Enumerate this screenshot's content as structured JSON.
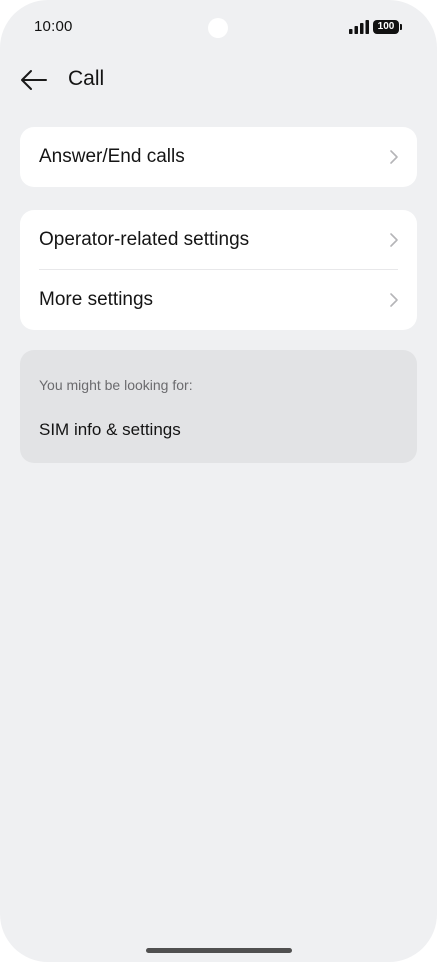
{
  "status_bar": {
    "time": "10:00",
    "battery_level": "100",
    "signal_icon": "signal-bars-icon",
    "battery_icon": "battery-icon"
  },
  "header": {
    "back_icon": "arrow-left-icon",
    "title": "Call"
  },
  "groups": [
    {
      "items": [
        {
          "label": "Answer/End calls",
          "icon": "chevron-right-icon"
        }
      ]
    },
    {
      "items": [
        {
          "label": "Operator-related settings",
          "icon": "chevron-right-icon"
        },
        {
          "label": "More settings",
          "icon": "chevron-right-icon"
        }
      ]
    }
  ],
  "suggestions": {
    "header": "You might be looking for:",
    "items": [
      {
        "label": "SIM info & settings"
      }
    ]
  },
  "colors": {
    "background": "#eff0f2",
    "card": "#ffffff",
    "suggestion_card": "#e2e3e5",
    "text_primary": "#151515",
    "text_secondary": "#6b6b6e",
    "chevron": "#b5b5b8"
  }
}
